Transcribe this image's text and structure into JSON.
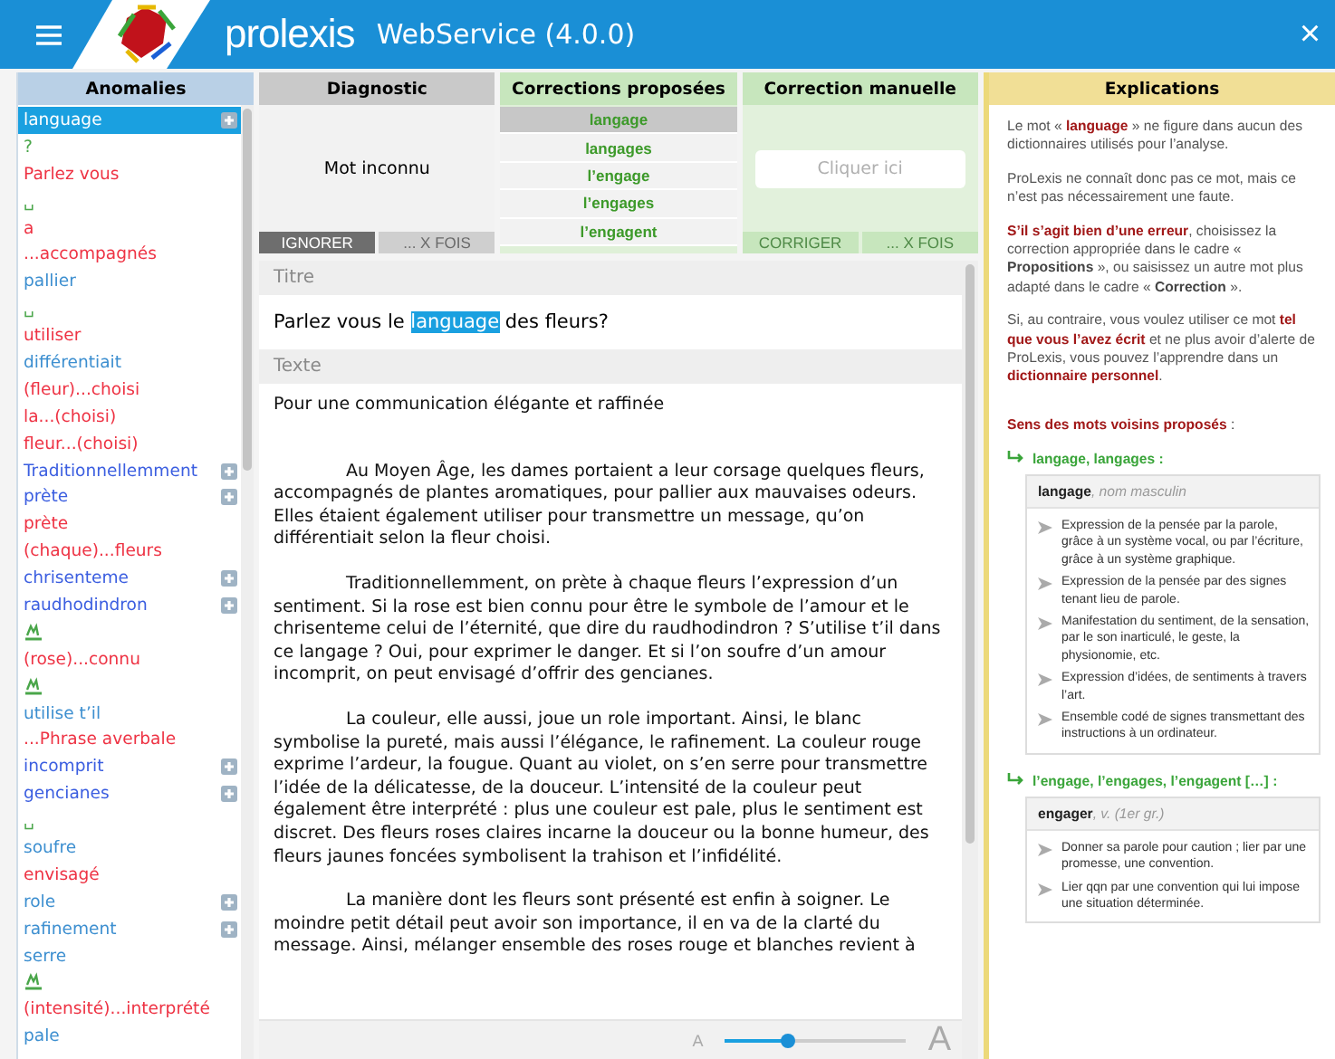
{
  "header": {
    "brand": "prolexis",
    "title": "WebService (4.0.0)",
    "close": "×"
  },
  "anomalies": {
    "title": "Anomalies",
    "items": [
      {
        "kind": "text",
        "label": "language",
        "color": "#ffffff",
        "selected": true,
        "plus": true
      },
      {
        "kind": "text",
        "label": "?",
        "color": "#4aa64a",
        "selected": false,
        "plus": false
      },
      {
        "kind": "text",
        "label": "Parlez vous",
        "color": "#ee3344",
        "selected": false,
        "plus": false
      },
      {
        "kind": "text",
        "label": "␣",
        "color": "#4aa64a",
        "selected": false,
        "plus": false
      },
      {
        "kind": "text",
        "label": "a",
        "color": "#ee3344",
        "selected": false,
        "plus": false
      },
      {
        "kind": "text",
        "label": "...accompagnés",
        "color": "#ee3344",
        "selected": false,
        "plus": false
      },
      {
        "kind": "text",
        "label": "pallier",
        "color": "#3d8fd0",
        "selected": false,
        "plus": false
      },
      {
        "kind": "text",
        "label": "␣",
        "color": "#4aa64a",
        "selected": false,
        "plus": false
      },
      {
        "kind": "text",
        "label": "utiliser",
        "color": "#ee3344",
        "selected": false,
        "plus": false
      },
      {
        "kind": "text",
        "label": "différentiait",
        "color": "#3d8fd0",
        "selected": false,
        "plus": false
      },
      {
        "kind": "text",
        "label": "(fleur)...choisi",
        "color": "#ee3344",
        "selected": false,
        "plus": false
      },
      {
        "kind": "text",
        "label": "la...(choisi)",
        "color": "#ee3344",
        "selected": false,
        "plus": false
      },
      {
        "kind": "text",
        "label": "fleur...(choisi)",
        "color": "#ee3344",
        "selected": false,
        "plus": false
      },
      {
        "kind": "text",
        "label": "Traditionnellemment",
        "color": "#3b5ee0",
        "selected": false,
        "plus": true
      },
      {
        "kind": "text",
        "label": "prète",
        "color": "#3b5ee0",
        "selected": false,
        "plus": true
      },
      {
        "kind": "text",
        "label": "prète",
        "color": "#ee3344",
        "selected": false,
        "plus": false
      },
      {
        "kind": "text",
        "label": "(chaque)...fleurs",
        "color": "#ee3344",
        "selected": false,
        "plus": false
      },
      {
        "kind": "text",
        "label": "chrisenteme",
        "color": "#3b5ee0",
        "selected": false,
        "plus": true
      },
      {
        "kind": "text",
        "label": "raudhodindron",
        "color": "#3b5ee0",
        "selected": false,
        "plus": true
      },
      {
        "kind": "symbol",
        "color": "#4aa64a",
        "selected": false,
        "plus": false
      },
      {
        "kind": "text",
        "label": "(rose)...connu",
        "color": "#ee3344",
        "selected": false,
        "plus": false
      },
      {
        "kind": "symbol",
        "color": "#4aa64a",
        "selected": false,
        "plus": false
      },
      {
        "kind": "text",
        "label": "utilise t’il",
        "color": "#3d8fd0",
        "selected": false,
        "plus": false
      },
      {
        "kind": "text",
        "label": "...Phrase averbale",
        "color": "#ee3344",
        "selected": false,
        "plus": false
      },
      {
        "kind": "text",
        "label": "incomprit",
        "color": "#3b5ee0",
        "selected": false,
        "plus": true
      },
      {
        "kind": "text",
        "label": "gencianes",
        "color": "#3b5ee0",
        "selected": false,
        "plus": true
      },
      {
        "kind": "text",
        "label": "␣",
        "color": "#4aa64a",
        "selected": false,
        "plus": false
      },
      {
        "kind": "text",
        "label": "soufre",
        "color": "#3d8fd0",
        "selected": false,
        "plus": false
      },
      {
        "kind": "text",
        "label": "envisagé",
        "color": "#ee3344",
        "selected": false,
        "plus": false
      },
      {
        "kind": "text",
        "label": "role",
        "color": "#3d8fd0",
        "selected": false,
        "plus": true
      },
      {
        "kind": "text",
        "label": "rafinement",
        "color": "#3d8fd0",
        "selected": false,
        "plus": true
      },
      {
        "kind": "text",
        "label": "serre",
        "color": "#3d8fd0",
        "selected": false,
        "plus": false
      },
      {
        "kind": "symbol",
        "color": "#4aa64a",
        "selected": false,
        "plus": false
      },
      {
        "kind": "text",
        "label": "(intensité)...interprété",
        "color": "#ee3344",
        "selected": false,
        "plus": false
      },
      {
        "kind": "text",
        "label": "pale",
        "color": "#3d8fd0",
        "selected": false,
        "plus": false
      }
    ]
  },
  "diagnostic": {
    "title": "Diagnostic",
    "message": "Mot inconnu",
    "buttons": [
      {
        "label": "IGNORER",
        "disabled": false
      },
      {
        "label": "... X FOIS",
        "disabled": true
      }
    ]
  },
  "corrections": {
    "title": "Corrections proposées",
    "items": [
      {
        "label": "langage",
        "selected": true
      },
      {
        "label": "langages",
        "selected": false
      },
      {
        "label": "l’engage",
        "selected": false
      },
      {
        "label": "l’engages",
        "selected": false
      },
      {
        "label": "l’engagent",
        "selected": false
      }
    ]
  },
  "manual": {
    "title": "Correction manuelle",
    "placeholder": "Cliquer ici",
    "buttons": [
      {
        "label": "CORRIGER",
        "disabled": true
      },
      {
        "label": "... X FOIS",
        "disabled": true
      }
    ]
  },
  "document": {
    "title_label": "Titre",
    "title_before": "Parlez vous le ",
    "title_highlight": "language",
    "title_after": " des fleurs?",
    "text_label": "Texte",
    "subtitle": "Pour une communication élégante et raffinée",
    "paragraphs": [
      "Au Moyen Âge, les dames portaient a leur corsage quelques fleurs, accompagnés de plantes aromatiques, pour pallier aux mauvaises odeurs. Elles étaient également utiliser pour transmettre un message, qu’on différentiait selon la fleur choisi.",
      "Traditionnellemment, on prète à chaque fleurs l’expression d’un sentiment. Si la rose est bien connu pour être le symbole de l’amour et le chrisenteme celui de l’éternité, que dire du raudhodindron ? S’utilise t’il dans ce langage ? Oui, pour exprimer le danger. Et si l’on soufre d’un amour incomprit, on peut envisagé d’offrir des gencianes.",
      "La couleur, elle aussi, joue un role important. Ainsi, le blanc symbolise la pureté, mais aussi l’élégance, le rafinement. La couleur rouge exprime l’ardeur, la fougue. Quant au violet, on s’en serre pour transmettre l’idée de la délicatesse, de la douceur. L’intensité de la couleur peut également être interprété : plus une couleur est pale, plus le sentiment est discret. Des fleurs roses claires incarne la douceur ou la bonne humeur, des fleurs jaunes foncées symbolisent la trahison et l’infidélité.",
      "La manière dont les fleurs sont présenté est enfin à soigner. Le moindre petit détail peut avoir son importance, il en va de la clarté du message. Ainsi, mélanger ensemble des roses rouge et blanches revient à"
    ],
    "font_small": "A",
    "font_large": "A",
    "level": 0.35
  },
  "explanations": {
    "title": "Explications",
    "paragraphs": [
      [
        {
          "kind": "plain",
          "text": "Le mot « "
        },
        {
          "kind": "alert",
          "text": "language"
        },
        {
          "kind": "plain",
          "text": " » ne figure dans aucun des dictionnaires utilisés pour l’analyse."
        }
      ],
      [
        {
          "kind": "plain",
          "text": "ProLexis ne connaît donc pas ce mot, mais ce n’est pas nécessairement une faute."
        }
      ],
      [
        {
          "kind": "alert",
          "text": "S’il s’agit bien d’une erreur"
        },
        {
          "kind": "plain",
          "text": ", choisissez la correction appropriée dans le cadre « "
        },
        {
          "kind": "strong",
          "text": "Propositions"
        },
        {
          "kind": "plain",
          "text": " », ou saisissez un autre mot plus adapté dans le cadre « "
        },
        {
          "kind": "strong",
          "text": "Correction"
        },
        {
          "kind": "plain",
          "text": " »."
        }
      ],
      [
        {
          "kind": "plain",
          "text": "Si, au contraire, vous voulez utiliser ce mot "
        },
        {
          "kind": "alert",
          "text": "tel que vous l’avez écrit"
        },
        {
          "kind": "plain",
          "text": " et ne plus avoir d’alerte de ProLexis, vous pouvez l’apprendre dans un "
        },
        {
          "kind": "alert",
          "text": "dictionnaire personnel"
        },
        {
          "kind": "plain",
          "text": "."
        }
      ]
    ],
    "senses_title": "Sens des mots voisins proposés",
    "senses_colon": " :",
    "groups": [
      {
        "heading": "langage, langages :",
        "word": "langage",
        "grammar": ", nom masculin",
        "senses": [
          "Expression de la pensée par la parole, grâce à un système vocal, ou par l’écriture, grâce à un système graphique.",
          "Expression de la pensée par des signes tenant lieu de parole.",
          "Manifestation du sentiment, de la sensation, par le son inarticulé, le geste, la physionomie, etc.",
          "Expression d’idées, de sentiments à travers l’art.",
          "Ensemble codé de signes transmettant des instructions à un ordinateur."
        ]
      },
      {
        "heading": "l’engage, l’engages, l’engagent […] :",
        "word": "engager",
        "grammar": ", v. (1er gr.)",
        "senses": [
          "Donner sa parole pour caution ; lier par une promesse, une convention.",
          "Lier qqn par une convention qui lui impose une situation déterminée."
        ]
      }
    ]
  }
}
